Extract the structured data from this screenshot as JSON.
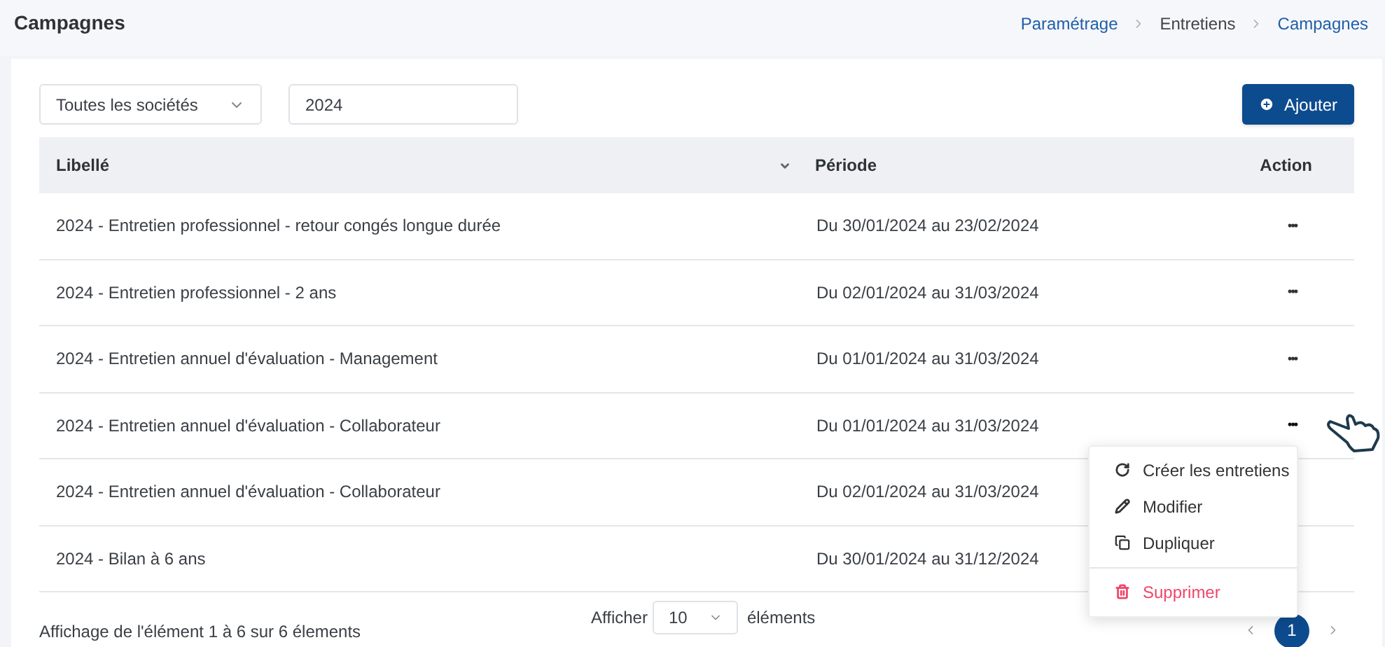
{
  "page_title": "Campagnes",
  "breadcrumb": [
    {
      "label": "Paramétrage",
      "link": true
    },
    {
      "label": "Entretiens",
      "link": false
    },
    {
      "label": "Campagnes",
      "link": true
    }
  ],
  "filters": {
    "company": "Toutes les sociétés",
    "year": "2024"
  },
  "add_button": "Ajouter",
  "table": {
    "columns": [
      "Libellé",
      "Période",
      "Action"
    ],
    "rows": [
      {
        "label": "2024 - Entretien professionnel - retour congés longue durée",
        "period": "Du 30/01/2024 au 23/02/2024",
        "action": "•••"
      },
      {
        "label": "2024 - Entretien professionnel - 2 ans",
        "period": "Du 02/01/2024 au 31/03/2024",
        "action": "•••"
      },
      {
        "label": "2024 - Entretien annuel d'évaluation - Management",
        "period": "Du 01/01/2024 au 31/03/2024",
        "action": "•••"
      },
      {
        "label": "2024 - Entretien annuel d'évaluation - Collaborateur",
        "period": "Du 01/01/2024 au 31/03/2024",
        "action": "•••",
        "menu": [
          {
            "label": "Créer les entretiens",
            "danger": false
          },
          {
            "label": "Modifier",
            "danger": false
          },
          {
            "label": "Dupliquer",
            "danger": false
          },
          {
            "label": "Supprimer",
            "danger": true
          }
        ]
      },
      {
        "label": "2024 - Entretien annuel d'évaluation - Collaborateur",
        "period": "Du 02/01/2024 au 31/03/2024"
      },
      {
        "label": "2024 - Bilan à 6 ans",
        "period": "Du 30/01/2024 au 31/12/2024"
      }
    ]
  },
  "footer": {
    "info": "Affichage de l'élément 1 à 6 sur 6 élements",
    "show_label": "Afficher",
    "page_size": "10",
    "items_label": "éléments",
    "pages": [
      {
        "label": "1",
        "selected": true
      }
    ]
  }
}
